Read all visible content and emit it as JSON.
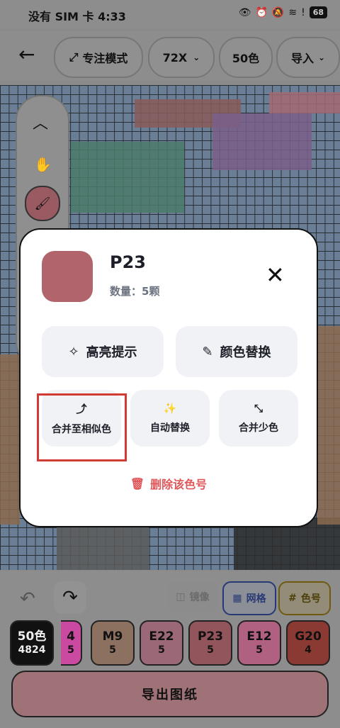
{
  "status_bar": {
    "carrier_time": "没有 SIM 卡 4:33",
    "battery": "68"
  },
  "toolbar": {
    "focus_mode": "专注模式",
    "size": "72X",
    "colors": "50色",
    "import": "导入"
  },
  "dialog": {
    "color_code": "P23",
    "quantity_label": "数量：",
    "quantity_value": "5颗",
    "swatch_color": "#b2646c",
    "highlight": "高亮提示",
    "replace_color": "颜色替换",
    "merge_similar": "合并至相似色",
    "auto_replace": "自动替换",
    "merge_few": "合并少色",
    "delete_color": "删除该色号"
  },
  "bottom": {
    "mirror": "镜像",
    "grid": "网格",
    "color_code": "色号",
    "export": "导出图纸"
  },
  "swatches": [
    {
      "code": "50色",
      "count": "4824",
      "color": "#111111"
    },
    {
      "code": "4",
      "count": "5",
      "color": "#c94aa0"
    },
    {
      "code": "M9",
      "count": "5",
      "color": "#8c7060"
    },
    {
      "code": "E22",
      "count": "5",
      "color": "#9a6876"
    },
    {
      "code": "P23",
      "count": "5",
      "color": "#92555c"
    },
    {
      "code": "E12",
      "count": "5",
      "color": "#b06080"
    },
    {
      "code": "G20",
      "count": "4",
      "color": "#8b3a33"
    }
  ]
}
